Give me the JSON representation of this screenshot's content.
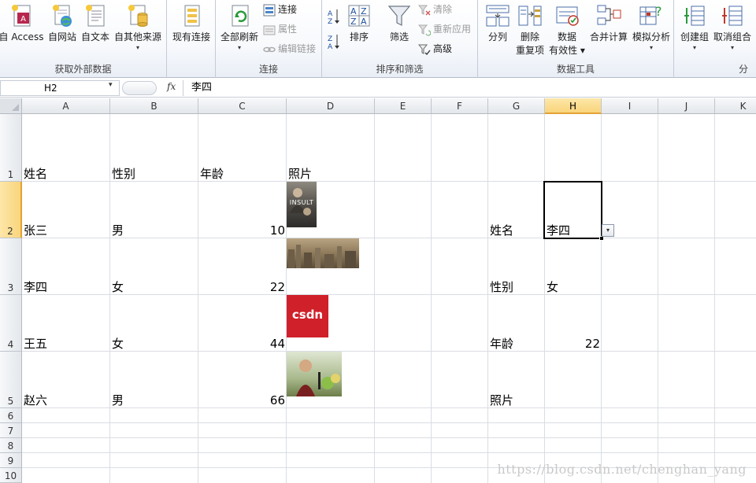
{
  "ribbon": {
    "groups": [
      {
        "label": "获取外部数据"
      },
      {
        "label": "连接"
      },
      {
        "label": "排序和筛选"
      },
      {
        "label": "数据工具"
      },
      {
        "label": "分"
      }
    ],
    "get_external": [
      {
        "label": "自 Access",
        "icon": "access-db-icon"
      },
      {
        "label": "自网站",
        "icon": "web-globe-icon"
      },
      {
        "label": "自文本",
        "icon": "text-file-icon"
      },
      {
        "label": "自其他来源",
        "icon": "other-sources-icon",
        "caret": "▾"
      },
      {
        "label": "现有连接",
        "icon": "existing-connections-icon"
      }
    ],
    "connections": {
      "refresh_all": {
        "label": "全部刷新",
        "caret": "▾"
      },
      "connections_btn": "连接",
      "properties_btn": "属性",
      "edit_links_btn": "编辑链接"
    },
    "sort_filter": {
      "sort_az": "A→Z",
      "sort_za": "Z→A",
      "sort_btn": "排序",
      "filter_btn": "筛选",
      "clear_btn": "清除",
      "reapply_btn": "重新应用",
      "advanced_btn": "高级"
    },
    "data_tools": [
      {
        "line1": "分列",
        "line2": "",
        "icon": "text-to-columns-icon"
      },
      {
        "line1": "删除",
        "line2": "重复项",
        "icon": "remove-duplicates-icon"
      },
      {
        "line1": "数据",
        "line2": "有效性 ▾",
        "icon": "data-validation-icon"
      },
      {
        "line1": "合并计算",
        "line2": "",
        "icon": "consolidate-icon"
      },
      {
        "line1": "模拟分析",
        "line2": "▾",
        "icon": "what-if-icon"
      }
    ],
    "outline": [
      {
        "label": "创建组",
        "caret": "▾",
        "icon": "group-icon"
      },
      {
        "label": "取消组合",
        "caret": "▾",
        "icon": "ungroup-icon"
      }
    ]
  },
  "formula_bar": {
    "name_box": "H2",
    "name_caret": "▾",
    "fx": "fx",
    "content": "李四"
  },
  "columns": [
    "A",
    "B",
    "C",
    "D",
    "E",
    "F",
    "G",
    "H",
    "I",
    "J",
    "K"
  ],
  "rows": [
    "1",
    "2",
    "3",
    "4",
    "5",
    "6",
    "7",
    "8",
    "9",
    "10"
  ],
  "selected_cell": "H2",
  "table": {
    "headers": [
      "姓名",
      "性别",
      "年龄",
      "照片"
    ],
    "rows": [
      {
        "name": "张三",
        "gender": "男",
        "age": "10"
      },
      {
        "name": "李四",
        "gender": "女",
        "age": "22"
      },
      {
        "name": "王五",
        "gender": "女",
        "age": "44"
      },
      {
        "name": "赵六",
        "gender": "男",
        "age": "66"
      }
    ]
  },
  "photos": [
    {
      "caption": "INSULT"
    },
    {
      "caption": ""
    },
    {
      "caption": "csdn"
    },
    {
      "caption": ""
    }
  ],
  "lookup": {
    "labels": [
      "姓名",
      "性别",
      "年龄",
      "照片"
    ],
    "name_value": "李四",
    "gender_value": "女",
    "age_value": "22",
    "dropdown_caret": "▾"
  },
  "watermark": "https://blog.csdn.net/chenghan_yang",
  "colors": {
    "selection_header": "#f9d57c",
    "csdn_red": "#d0202a",
    "grid_line": "#d9dde3"
  }
}
